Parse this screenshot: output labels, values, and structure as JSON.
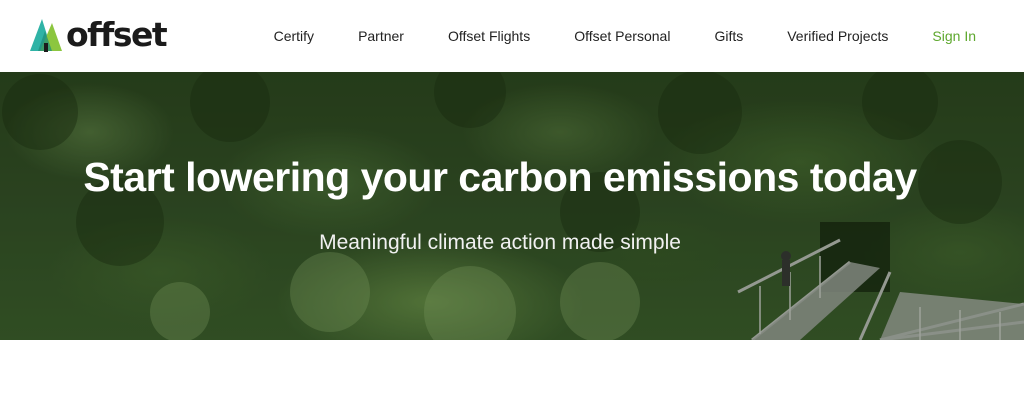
{
  "brand": {
    "name": "offset",
    "colors": {
      "logo_teal": "#2fb3a6",
      "logo_green": "#8cc63f",
      "logo_dark": "#1b1b1b",
      "signin_green": "#5ea82e"
    },
    "icon": "tree-logo-icon"
  },
  "nav": {
    "items": [
      {
        "label": "Certify"
      },
      {
        "label": "Partner"
      },
      {
        "label": "Offset Flights"
      },
      {
        "label": "Offset Personal"
      },
      {
        "label": "Gifts"
      },
      {
        "label": "Verified Projects"
      }
    ],
    "signin": "Sign In"
  },
  "hero": {
    "title": "Start lowering your carbon emissions today",
    "subtitle": "Meaningful climate action made simple",
    "image": "forest canopy with elevated walkway"
  }
}
